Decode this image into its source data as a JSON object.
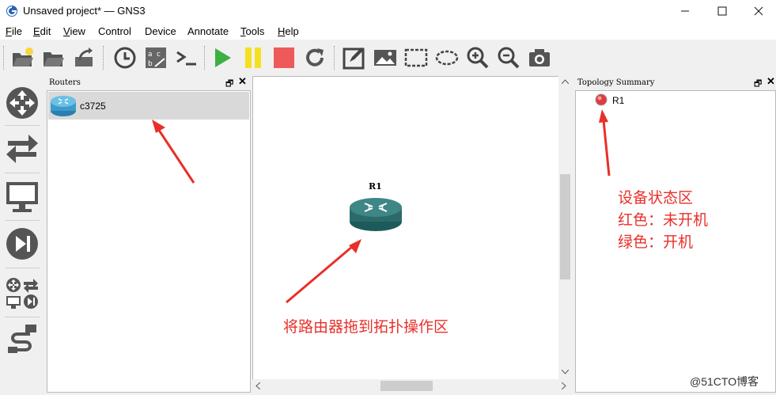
{
  "window": {
    "title": "Unsaved project* — GNS3",
    "controls": {
      "minimize": "—",
      "maximize": "☐",
      "close": "✕"
    }
  },
  "menu": [
    {
      "pre": "",
      "u": "F",
      "post": "ile"
    },
    {
      "pre": "",
      "u": "E",
      "post": "dit"
    },
    {
      "pre": "",
      "u": "V",
      "post": "iew"
    },
    {
      "pre": "",
      "u": "",
      "post": "Control"
    },
    {
      "pre": "",
      "u": "",
      "post": "Device"
    },
    {
      "pre": "",
      "u": "",
      "post": "Annotate"
    },
    {
      "pre": "",
      "u": "T",
      "post": "ools"
    },
    {
      "pre": "",
      "u": "H",
      "post": "elp"
    }
  ],
  "toolbar": {
    "icons": [
      "new-project-icon",
      "open-project-icon",
      "save-project-icon",
      "snapshot-clock-icon",
      "show-labels-icon",
      "console-icon",
      "start-icon",
      "suspend-icon",
      "stop-icon",
      "reload-icon",
      "add-note-icon",
      "insert-image-icon",
      "draw-rectangle-icon",
      "draw-ellipse-icon",
      "zoom-in-icon",
      "zoom-out-icon",
      "screenshot-icon"
    ],
    "colors": {
      "start": "#3cb043",
      "suspend": "#f5e020",
      "stop": "#ee5a5a",
      "icon": "#444444"
    }
  },
  "leftbar": {
    "icons": [
      "routers-icon",
      "switches-icon",
      "end-devices-icon",
      "security-devices-icon",
      "all-devices-icon",
      "add-link-icon"
    ]
  },
  "routers_panel": {
    "title": "Routers",
    "items": [
      {
        "label": "c3725"
      }
    ]
  },
  "canvas": {
    "nodes": [
      {
        "label": "R1"
      }
    ]
  },
  "topology_panel": {
    "title": "Topology Summary",
    "items": [
      {
        "label": "R1",
        "status_color": "#e03c3c"
      }
    ]
  },
  "annotations": {
    "drag_hint": "将路由器拖到拓扑操作区",
    "status_area_lines": [
      "设备状态区",
      "红色：未开机",
      "绿色：开机"
    ],
    "color": "#e8302a"
  },
  "watermark": "@51CTO博客"
}
